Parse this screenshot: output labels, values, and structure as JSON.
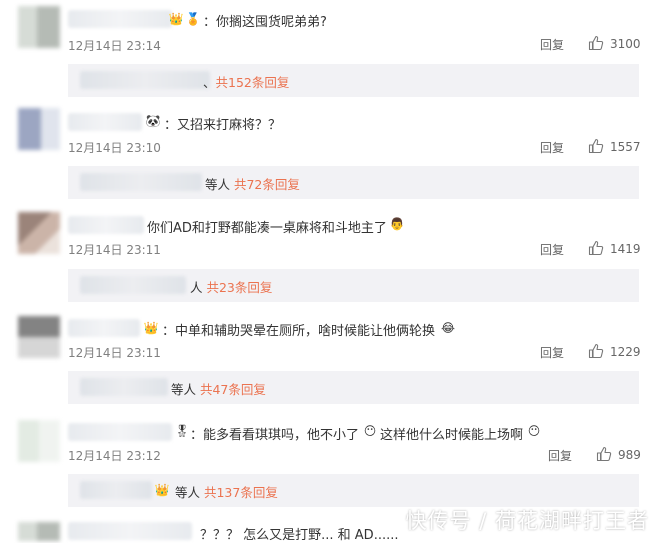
{
  "comments": [
    {
      "text": "：你搁这囤货呢弟弟?",
      "time": "12月14日 23:14",
      "reply_label": "回复",
      "likes": "3100",
      "sub": {
        "prefix": "、",
        "link": "共152条回复"
      }
    },
    {
      "text": "：又招来打麻将？？",
      "time": "12月14日 23:10",
      "reply_label": "回复",
      "likes": "1557",
      "sub": {
        "prefix": "等人 ",
        "link": "共72条回复"
      }
    },
    {
      "text": "你们AD和打野都能凑一桌麻将和斗地主了",
      "time": "12月14日 23:11",
      "reply_label": "回复",
      "likes": "1419",
      "sub": {
        "prefix": "人 ",
        "link": "共23条回复"
      }
    },
    {
      "text": "：中单和辅助哭晕在厕所，啥时候能让他俩轮换",
      "time": "12月14日 23:11",
      "reply_label": "回复",
      "likes": "1229",
      "sub": {
        "prefix": "等人 ",
        "link": "共47条回复"
      }
    },
    {
      "text_a": "：能多看看琪琪吗，他不小了",
      "text_b": "这样他什么时候能上场啊",
      "time": "12月14日 23:12",
      "reply_label": "回复",
      "likes": "989",
      "sub": {
        "prefix": "等人 ",
        "link": "共137条回复"
      }
    },
    {
      "text": "？？？ 怎么又是打野... 和 AD......"
    }
  ],
  "watermark": "快传号 / 荷花湖畔打王者",
  "colors": {
    "link": "#eb7350",
    "sub_bg": "#f2f2f5",
    "time": "#808080"
  },
  "icons": {
    "like": "thumbs-up-icon"
  }
}
